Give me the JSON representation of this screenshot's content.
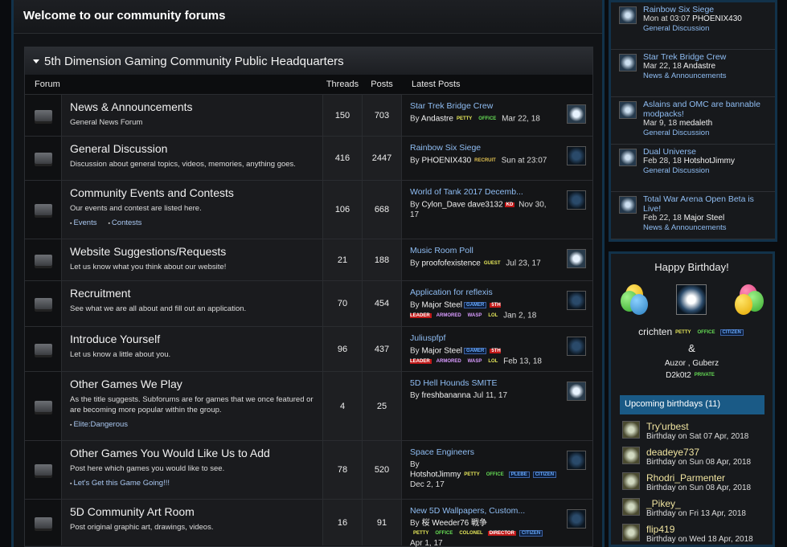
{
  "welcome": "Welcome to our community forums",
  "category": "5th Dimension Gaming Community Public Headquarters",
  "columns": {
    "forum": "Forum",
    "threads": "Threads",
    "posts": "Posts",
    "latest": "Latest Posts"
  },
  "forums": [
    {
      "title": "News & Announcements",
      "desc": "General News Forum",
      "subs": [],
      "threads": "150",
      "posts": "703",
      "lp_title": "Star Trek Bridge Crew",
      "lp_by": "By",
      "lp_user": "Andastre",
      "lp_badges": [
        "PETTY",
        "OFFICE"
      ],
      "lp_date": "Mar 22, 18"
    },
    {
      "title": "General Discussion",
      "desc": "Discussion about general topics, videos, memories, anything goes.",
      "subs": [],
      "threads": "416",
      "posts": "2447",
      "lp_title": "Rainbow Six Siege",
      "lp_by": "By",
      "lp_user": "PHOENIX430",
      "lp_badges": [
        "RECRUIT"
      ],
      "lp_date": "Sun at 23:07"
    },
    {
      "title": "Community Events and Contests",
      "desc": "Our events and contest are listed here.",
      "subs": [
        "Events",
        "Contests"
      ],
      "threads": "106",
      "posts": "668",
      "lp_title": "World of Tank 2017 Decemb...",
      "lp_by": "By",
      "lp_user": "Cylon_Dave dave3132",
      "lp_badges": [
        "KD"
      ],
      "lp_date": "Nov 30, 17"
    },
    {
      "title": "Website Suggestions/Requests",
      "desc": "Let us know what you think about our website!",
      "subs": [],
      "threads": "21",
      "posts": "188",
      "lp_title": "Music Room Poll",
      "lp_by": "By",
      "lp_user": "proofofexistence",
      "lp_badges": [
        "GUEST"
      ],
      "lp_date": "Jul 23, 17"
    },
    {
      "title": "Recruitment",
      "desc": "See what we are all about and fill out an application.",
      "subs": [],
      "threads": "70",
      "posts": "454",
      "lp_title": "Application for reflexis",
      "lp_by": "By",
      "lp_user": "Major Steel",
      "lp_badges": [
        "GAMER",
        "5TH LEADER",
        "ARMORED",
        "WASP",
        "LOL"
      ],
      "lp_date": "Jan 2, 18"
    },
    {
      "title": "Introduce Yourself",
      "desc": "Let us know a little about you.",
      "subs": [],
      "threads": "96",
      "posts": "437",
      "lp_title": "Juliuspfpf",
      "lp_by": "By",
      "lp_user": "Major Steel",
      "lp_badges": [
        "GAMER",
        "5TH LEADER",
        "ARMORED",
        "WASP",
        "LOL"
      ],
      "lp_date": "Feb 13, 18"
    },
    {
      "title": "Other Games We Play",
      "desc": "As the title suggests. Subforums are for games that we once featured or are becoming more popular within the group.",
      "subs": [
        "Elite:Dangerous"
      ],
      "threads": "4",
      "posts": "25",
      "lp_title": "5D Hell Hounds SMITE",
      "lp_by": "By",
      "lp_user": "freshbananna",
      "lp_badges": [],
      "lp_date": "Jul 11, 17"
    },
    {
      "title": "Other Games You Would Like Us to Add",
      "desc": "Post here which games you would like to see.",
      "subs": [
        "Let's Get this Game Going!!!"
      ],
      "threads": "78",
      "posts": "520",
      "lp_title": "Space Engineers",
      "lp_by": "By",
      "lp_user": "HotshotJimmy",
      "lp_badges": [
        "PETTY",
        "OFFICE",
        "PLEBE",
        "CITIZEN"
      ],
      "lp_date": "Dec 2, 17"
    },
    {
      "title": "5D Community Art Room",
      "desc": "Post original graphic art, drawings, videos.",
      "subs": [],
      "threads": "16",
      "posts": "91",
      "lp_title": "New 5D Wallpapers, Custom...",
      "lp_by": "By",
      "lp_user": "桜 Weeder76 戦争",
      "lp_badges": [
        "PETTY",
        "OFFICE",
        "COLONEL",
        "DIRECTOR",
        "CITIZEN"
      ],
      "lp_date": "Apr 1, 17"
    }
  ],
  "recent": [
    {
      "title": "Rainbow Six Siege",
      "meta": "Mon at 03:07",
      "user": "PHOENIX430",
      "forum": "General Discussion"
    },
    {
      "title": "Star Trek Bridge Crew",
      "meta": "Mar 22, 18",
      "user": "Andastre",
      "forum": "News & Announcements"
    },
    {
      "title": "Aslains and OMC are bannable modpacks!",
      "meta": "Mar 9, 18",
      "user": "medaleth",
      "forum": "General Discussion"
    },
    {
      "title": "Dual Universe",
      "meta": "Feb 28, 18",
      "user": "HotshotJimmy",
      "forum": "General Discussion"
    },
    {
      "title": "Total War Arena Open Beta is Live!",
      "meta": "Feb 22, 18",
      "user": "Major Steel",
      "forum": "News & Announcements"
    }
  ],
  "birthday": {
    "title": "Happy Birthday!",
    "main_user": "crichten",
    "amp": "&",
    "others_line": "Auzor , Guberz",
    "last_user": "D2k0t2",
    "upcoming_label": "Upcoming birthdays (11)",
    "upcoming": [
      {
        "name": "Try'urbest",
        "date": "Birthday on Sat 07 Apr, 2018"
      },
      {
        "name": "deadeye737",
        "date": "Birthday on Sun 08 Apr, 2018"
      },
      {
        "name": "Rhodri_Parmenter",
        "date": "Birthday on Sun 08 Apr, 2018"
      },
      {
        "name": "_Pikey_",
        "date": "Birthday on Fri 13 Apr, 2018"
      },
      {
        "name": "flip419",
        "date": "Birthday on Wed 18 Apr, 2018"
      }
    ]
  }
}
